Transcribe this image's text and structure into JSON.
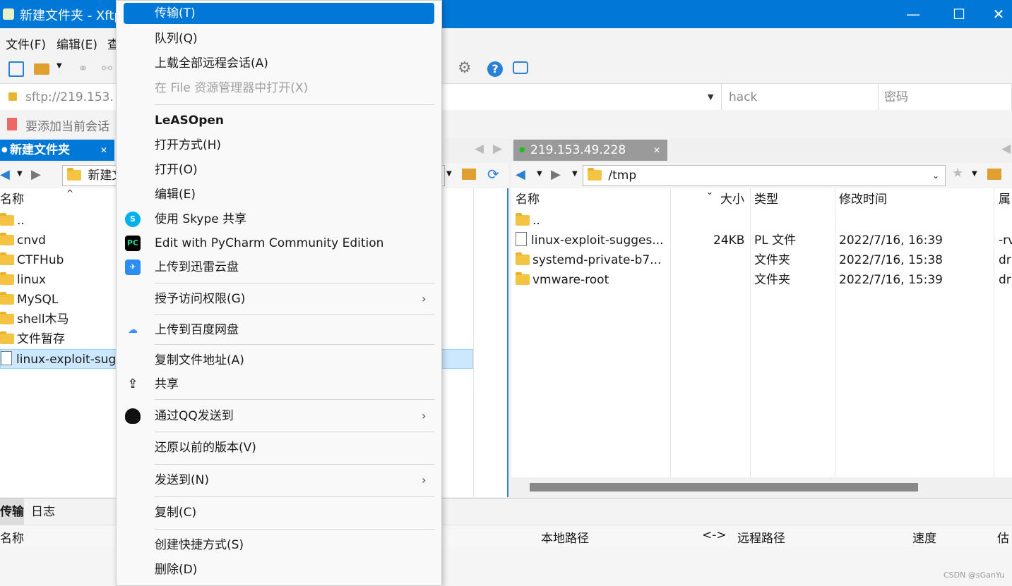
{
  "window": {
    "title": "新建文件夹 - Xftp",
    "minimize": "—",
    "maximize": "☐",
    "close": "✕"
  },
  "menubar": {
    "file": "文件(F)",
    "edit": "编辑(E)",
    "view": "查"
  },
  "address": {
    "url": "sftp://219.153.",
    "user": "hack",
    "password_placeholder": "密码"
  },
  "linkbar": {
    "text": "要添加当前会话"
  },
  "left_pane": {
    "tab": "新建文件夹",
    "path": "新建文",
    "col_name": "名称",
    "items": [
      "..",
      "cnvd",
      "CTFHub",
      "linux",
      "MySQL",
      "shell木马",
      "文件暂存",
      "linux-exploit-sug"
    ]
  },
  "right_pane": {
    "tab": "219.153.49.228",
    "path": "/tmp",
    "columns": {
      "name": "名称",
      "size": "大小",
      "type": "类型",
      "mtime": "修改时间",
      "attr": "属"
    },
    "rows": [
      {
        "name": "..",
        "size": "",
        "type": "",
        "mtime": "",
        "attr": ""
      },
      {
        "name": "linux-exploit-sugges...",
        "size": "24KB",
        "type": "PL 文件",
        "mtime": "2022/7/16, 16:39",
        "attr": "-rv"
      },
      {
        "name": "systemd-private-b7...",
        "size": "",
        "type": "文件夹",
        "mtime": "2022/7/16, 15:38",
        "attr": "dr"
      },
      {
        "name": "vmware-root",
        "size": "",
        "type": "文件夹",
        "mtime": "2022/7/16, 15:39",
        "attr": "dr"
      }
    ]
  },
  "bottom": {
    "tabs": [
      "传输",
      "日志"
    ],
    "columns": {
      "name": "名称",
      "local": "本地路径",
      "dir": "<->",
      "remote": "远程路径",
      "speed": "速度",
      "est": "估"
    }
  },
  "context_menu": {
    "transfer": "传输(T)",
    "queue": "队列(Q)",
    "upload_all": "上载全部远程会话(A)",
    "open_in_explorer": "在 File 资源管理器中打开(X)",
    "leasopen": "LeASOpen",
    "open_with": "打开方式(H)",
    "open": "打开(O)",
    "edit": "编辑(E)",
    "skype_share": "使用 Skype 共享",
    "pycharm": "Edit with PyCharm Community Edition",
    "xunlei": "上传到迅雷云盘",
    "grant_access": "授予访问权限(G)",
    "baidu": "上传到百度网盘",
    "copy_path": "复制文件地址(A)",
    "share": "共享",
    "qq_send": "通过QQ发送到",
    "restore": "还原以前的版本(V)",
    "send_to": "发送到(N)",
    "copy": "复制(C)",
    "create_shortcut": "创建快捷方式(S)",
    "delete": "删除(D)",
    "arrow": "›",
    "pycharm_icon_text": "PC"
  },
  "watermark": "CSDN @sGanYu"
}
